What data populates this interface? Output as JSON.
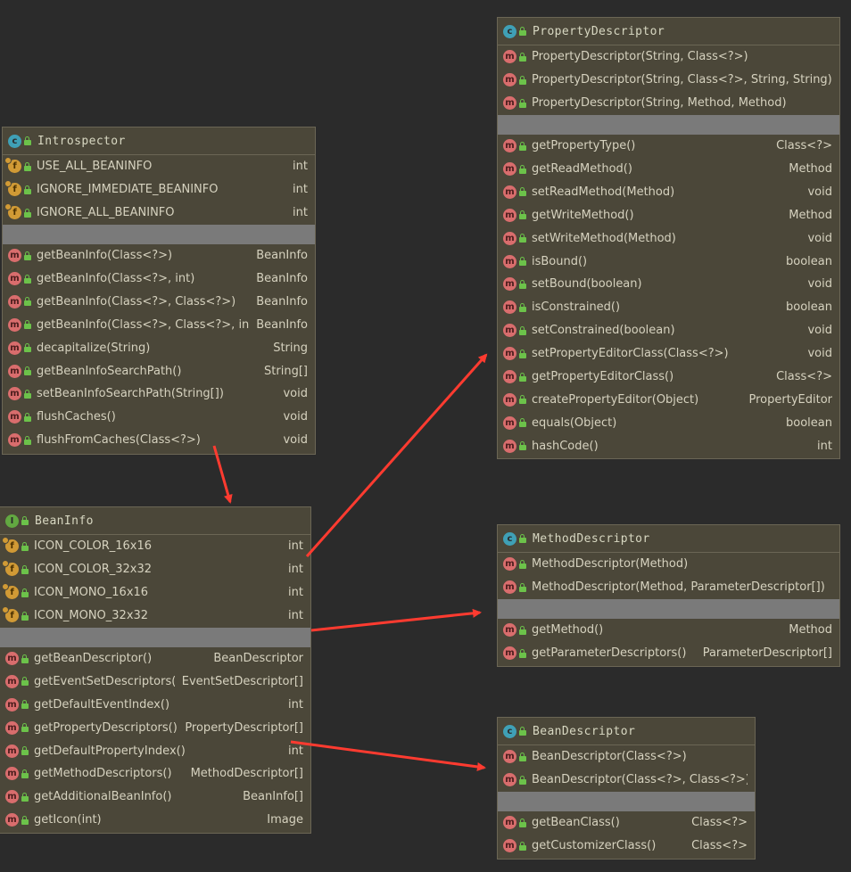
{
  "colors": {
    "arrow": "#ff3b30",
    "class_icon": "#3fa0b6",
    "interface_icon": "#62a841",
    "method_icon": "#d96d6d",
    "field_icon": "#d19a35"
  },
  "introspector": {
    "title": "Introspector",
    "icon": "class-icon",
    "fields": [
      {
        "name": "USE_ALL_BEANINFO",
        "type": "int"
      },
      {
        "name": "IGNORE_IMMEDIATE_BEANINFO",
        "type": "int"
      },
      {
        "name": "IGNORE_ALL_BEANINFO",
        "type": "int"
      }
    ],
    "methods": [
      {
        "name": "getBeanInfo(Class<?>)",
        "type": "BeanInfo"
      },
      {
        "name": "getBeanInfo(Class<?>, int)",
        "type": "BeanInfo"
      },
      {
        "name": "getBeanInfo(Class<?>, Class<?>)",
        "type": "BeanInfo"
      },
      {
        "name": "getBeanInfo(Class<?>, Class<?>, int)",
        "type": "BeanInfo"
      },
      {
        "name": "decapitalize(String)",
        "type": "String"
      },
      {
        "name": "getBeanInfoSearchPath()",
        "type": "String[]"
      },
      {
        "name": "setBeanInfoSearchPath(String[])",
        "type": "void"
      },
      {
        "name": "flushCaches()",
        "type": "void"
      },
      {
        "name": "flushFromCaches(Class<?>)",
        "type": "void"
      }
    ]
  },
  "beaninfo": {
    "title": "BeanInfo",
    "icon": "interface-icon",
    "fields": [
      {
        "name": "ICON_COLOR_16x16",
        "type": "int"
      },
      {
        "name": "ICON_COLOR_32x32",
        "type": "int"
      },
      {
        "name": "ICON_MONO_16x16",
        "type": "int"
      },
      {
        "name": "ICON_MONO_32x32",
        "type": "int"
      }
    ],
    "methods": [
      {
        "name": "getBeanDescriptor()",
        "type": "BeanDescriptor"
      },
      {
        "name": "getEventSetDescriptors()",
        "type": "EventSetDescriptor[]"
      },
      {
        "name": "getDefaultEventIndex()",
        "type": "int"
      },
      {
        "name": "getPropertyDescriptors()",
        "type": "PropertyDescriptor[]"
      },
      {
        "name": "getDefaultPropertyIndex()",
        "type": "int"
      },
      {
        "name": "getMethodDescriptors()",
        "type": "MethodDescriptor[]"
      },
      {
        "name": "getAdditionalBeanInfo()",
        "type": "BeanInfo[]"
      },
      {
        "name": "getIcon(int)",
        "type": "Image"
      }
    ]
  },
  "propertydescriptor": {
    "title": "PropertyDescriptor",
    "icon": "class-icon",
    "constructors": [
      {
        "name": "PropertyDescriptor(String, Class<?>)",
        "type": ""
      },
      {
        "name": "PropertyDescriptor(String, Class<?>, String, String)",
        "type": ""
      },
      {
        "name": "PropertyDescriptor(String, Method, Method)",
        "type": ""
      }
    ],
    "methods": [
      {
        "name": "getPropertyType()",
        "type": "Class<?>"
      },
      {
        "name": "getReadMethod()",
        "type": "Method"
      },
      {
        "name": "setReadMethod(Method)",
        "type": "void"
      },
      {
        "name": "getWriteMethod()",
        "type": "Method"
      },
      {
        "name": "setWriteMethod(Method)",
        "type": "void"
      },
      {
        "name": "isBound()",
        "type": "boolean"
      },
      {
        "name": "setBound(boolean)",
        "type": "void"
      },
      {
        "name": "isConstrained()",
        "type": "boolean"
      },
      {
        "name": "setConstrained(boolean)",
        "type": "void"
      },
      {
        "name": "setPropertyEditorClass(Class<?>)",
        "type": "void"
      },
      {
        "name": "getPropertyEditorClass()",
        "type": "Class<?>"
      },
      {
        "name": "createPropertyEditor(Object)",
        "type": "PropertyEditor"
      },
      {
        "name": "equals(Object)",
        "type": "boolean"
      },
      {
        "name": "hashCode()",
        "type": "int"
      }
    ]
  },
  "methoddescriptor": {
    "title": "MethodDescriptor",
    "icon": "class-icon",
    "constructors": [
      {
        "name": "MethodDescriptor(Method)",
        "type": ""
      },
      {
        "name": "MethodDescriptor(Method, ParameterDescriptor[])",
        "type": ""
      }
    ],
    "methods": [
      {
        "name": "getMethod()",
        "type": "Method"
      },
      {
        "name": "getParameterDescriptors()",
        "type": "ParameterDescriptor[]"
      }
    ]
  },
  "beandescriptor": {
    "title": "BeanDescriptor",
    "icon": "class-icon",
    "constructors": [
      {
        "name": "BeanDescriptor(Class<?>)",
        "type": ""
      },
      {
        "name": "BeanDescriptor(Class<?>, Class<?>)",
        "type": ""
      }
    ],
    "methods": [
      {
        "name": "getBeanClass()",
        "type": "Class<?>"
      },
      {
        "name": "getCustomizerClass()",
        "type": "Class<?>"
      }
    ]
  }
}
